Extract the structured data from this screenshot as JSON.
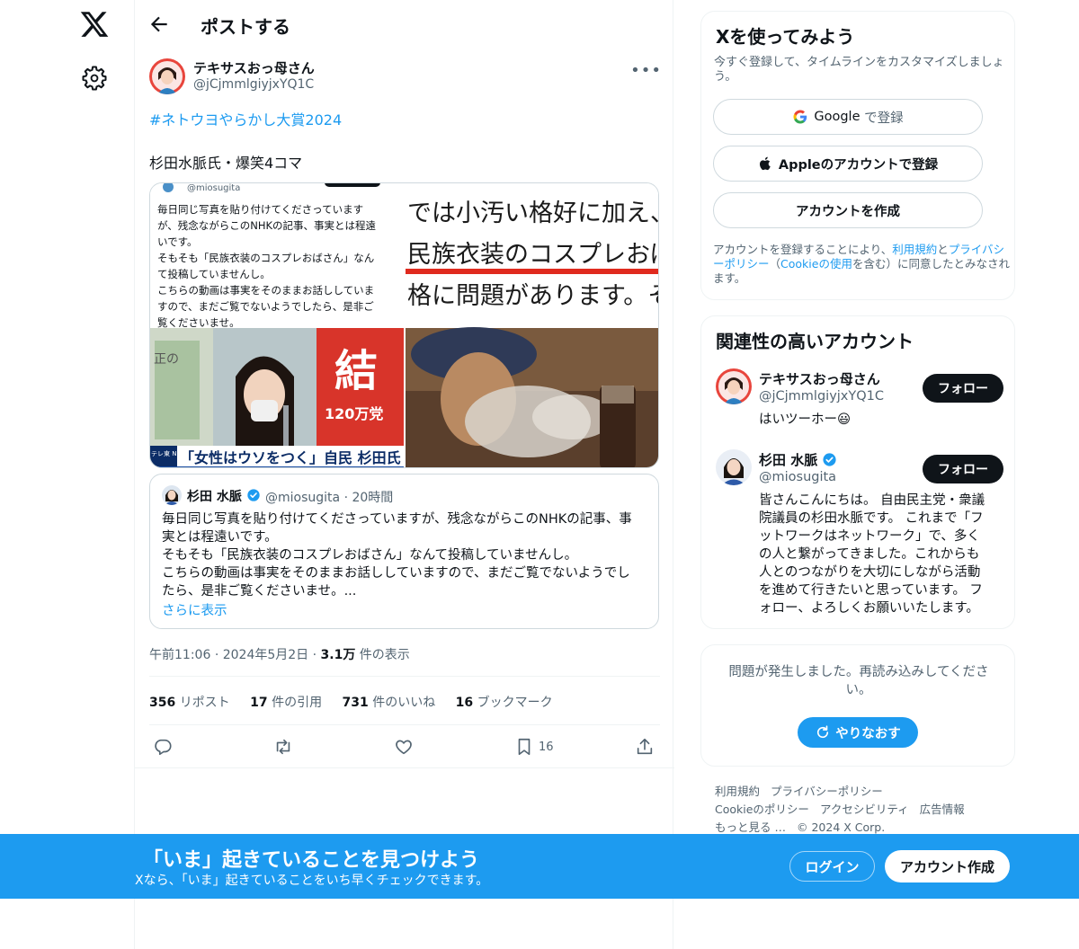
{
  "header": {
    "title": "ポストする"
  },
  "post": {
    "author_name": "テキサスおっ母さん",
    "author_handle": "@jCjmmlgiyjxYQ1C",
    "hashtag": "#ネトウヨやらかし大賞2024",
    "text": "杉田水脈氏・爆笑4コマ",
    "media": {
      "panel1_handle": "@miosugita",
      "panel1_lines": [
        "毎日同じ写真を貼り付けてくださっています",
        "が、残念ながらこのNHKの記事、事実とは程遠",
        "いです。",
        "そもそも「民族衣装のコスプレおばさん」なん",
        "て投稿していませんし。",
        "こちらの動画は事実をそのままお話ししていま",
        "すので、まだご覧でないようでしたら、是非ご",
        "覧くださいませ。"
      ],
      "panel2_lines": [
        "では小汚い格好に加え、",
        "民族衣装のコスプレおば",
        "格に問題があります。そ"
      ],
      "panel3_tag": "テレ東 NEWS",
      "panel3_caption": "「女性はウソをつく」自民 杉田氏",
      "panel3_sign": "結",
      "panel3_sign_sub": "120万党",
      "panel3_side": "正の"
    },
    "quote": {
      "name": "杉田 水脈",
      "handle": "@miosugita",
      "time": "· 20時間",
      "lines": [
        "毎日同じ写真を貼り付けてくださっていますが、残念ながらこのNHKの記事、事",
        "実とは程遠いです。",
        "そもそも「民族衣装のコスプレおばさん」なんて投稿していませんし。",
        "こちらの動画は事実をそのままお話ししていますので、まだご覧でないようでし",
        "たら、是非ご覧くださいませ。..."
      ],
      "more": "さらに表示"
    },
    "meta": {
      "time": "午前11:06",
      "sep1": "·",
      "date": "2024年5月2日",
      "sep2": "·",
      "views": "3.1万",
      "views_label": "件の表示"
    },
    "stats": {
      "reposts": "356",
      "reposts_label": "リポスト",
      "quotes": "17",
      "quotes_label": "件の引用",
      "likes": "731",
      "likes_label": "件のいいね",
      "bookmarks": "16",
      "bookmarks_label": "ブックマーク"
    },
    "bookmark_count": "16"
  },
  "signup": {
    "title": "Xを使ってみよう",
    "subtitle": "今すぐ登録して、タイムラインをカスタマイズしましょう。",
    "google": {
      "brand": "Google",
      "label": "で登録"
    },
    "apple": "Appleのアカウントで登録",
    "create": "アカウントを作成",
    "legal": {
      "a": "アカウントを登録することにより、",
      "terms": "利用規約",
      "b": "と",
      "privacy": "プライバシーポリシー",
      "c": "（",
      "cookie": "Cookieの使用",
      "d": "を含む）に同意したとみなされます。"
    }
  },
  "related": {
    "title": "関連性の高いアカウント",
    "accounts": [
      {
        "name": "テキサスおっ母さん",
        "handle": "@jCjmmlgiyjxYQ1C",
        "bio": [
          "はいツーホー😃"
        ],
        "follow": "フォロー"
      },
      {
        "name": "杉田 水脈",
        "handle": "@miosugita",
        "bio": [
          "皆さんこんにちは。 自由民主党・衆議",
          "院議員の杉田水脈です。 これまで「フ",
          "ットワークはネットワーク」で、多く",
          "の人と繋がってきました。これからも",
          "人とのつながりを大切にしながら活動",
          "を進めて行きたいと思っています。 フ",
          "ォロー、よろしくお願いいたします。"
        ],
        "follow": "フォロー"
      }
    ]
  },
  "error": {
    "message": "問題が発生しました。再読み込みしてください。",
    "retry": "やりなおす"
  },
  "footer": {
    "terms": "利用規約",
    "privacy": "プライバシーポリシー",
    "cookie": "Cookieのポリシー",
    "accessibility": "アクセシビリティ",
    "ads": "広告情報",
    "more": "もっと見る …",
    "copyright": "© 2024 X Corp."
  },
  "banner": {
    "title": "「いま」起きていることを見つけよう",
    "subtitle": "Xなら、「いま」起きていることをいち早くチェックできます。",
    "login": "ログイン",
    "create": "アカウント作成"
  },
  "colors": {
    "accent": "#1d9bf0",
    "text": "#0f1419",
    "muted": "#536471",
    "border": "#cfd9de",
    "verified": "#1d9bf0"
  }
}
